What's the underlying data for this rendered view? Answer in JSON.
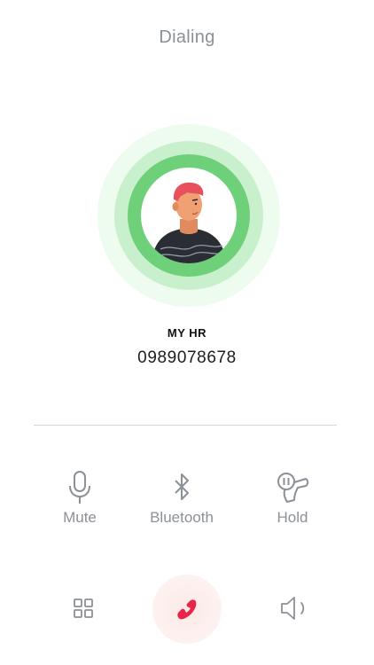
{
  "call": {
    "status": "Dialing",
    "contact_name": "MY HR",
    "phone_number": "0989078678"
  },
  "actions": [
    {
      "label": "Mute",
      "icon": "microphone-icon"
    },
    {
      "label": "Bluetooth",
      "icon": "bluetooth-icon"
    },
    {
      "label": "Hold",
      "icon": "hold-icon"
    }
  ],
  "bottom_bar": {
    "keypad_icon": "keypad-grid-icon",
    "end_call_icon": "phone-hangup-icon",
    "speaker_icon": "speaker-icon"
  },
  "colors": {
    "ring_outer": "#eefbef",
    "ring_middle": "#c9f0cc",
    "ring_inner": "#6fd07a",
    "end_call_accent": "#e8244a",
    "muted_text": "#8c9097"
  }
}
